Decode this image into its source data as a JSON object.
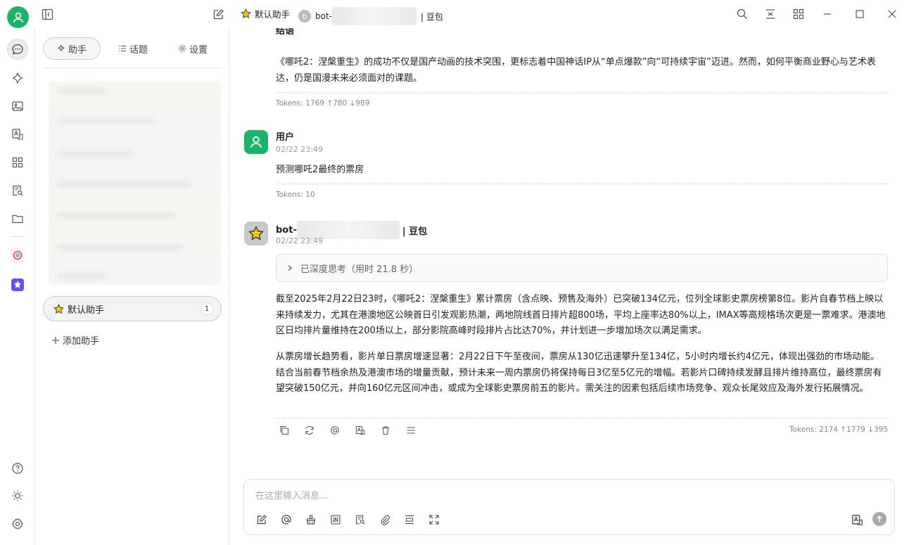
{
  "titlebar": {
    "assistant_label": "默认助手",
    "bot_prefix": "bot-",
    "bot_initial": "b",
    "bot_suffix": "| 豆包"
  },
  "sidebar": {
    "tabs": [
      {
        "label": "助手",
        "icon": "sparkle-icon"
      },
      {
        "label": "话题",
        "icon": "list-icon"
      },
      {
        "label": "设置",
        "icon": "gear-icon"
      }
    ],
    "assistant_item": {
      "label": "默认助手",
      "badge": "1"
    },
    "add_assistant": "添加助手"
  },
  "chat": {
    "prev_heading": "结语",
    "prev_text": "《哪吒2：涅槃重生》的成功不仅是国产动画的技术突围，更标志着中国神话IP从“单点爆款”向“可持续宇宙”迈进。然而，如何平衡商业野心与艺术表达，仍是国漫未来必须面对的课题。",
    "prev_tokens": "Tokens: 1769 ↑780 ↓989",
    "user_name": "用户",
    "user_time": "02/22 23:49",
    "user_text": "预测哪吒2最终的票房",
    "user_tokens": "Tokens: 10",
    "bot_name_prefix": "bot-",
    "bot_name_suffix": "| 豆包",
    "bot_time": "02/22 23:49",
    "think_label": "已深度思考（用时 21.8 秒）",
    "bot_para1": "截至2025年2月22日23时，《哪吒2：涅槃重生》累计票房（含点映、预售及海外）已突破134亿元，位列全球影史票房榜第8位。影片自春节档上映以来持续发力，尤其在港澳地区公映首日引发观影热潮，两地院线首日排片超800场，平均上座率达80%以上，IMAX等高规格场次更是一票难求。港澳地区日均排片量维持在200场以上，部分影院高峰时段排片占比达70%，并计划进一步增加场次以满足需求。",
    "bot_para2": "从票房增长趋势看，影片单日票房增速显著：2月22日下午至夜间，票房从130亿迅速攀升至134亿，5小时内增长约4亿元，体现出强劲的市场动能。结合当前春节档余热及港澳市场的增量贡献，预计未来一周内票房仍将保持每日3亿至5亿元的增幅。若影片口碑持续发酵且排片维持高位，最终票房有望突破150亿元，并向160亿元区间冲击，或成为全球影史票房前五的影片。需关注的因素包括后续市场竞争、观众长尾效应及海外发行拓展情况。",
    "bot_tokens": "Tokens: 2174 ↑1779 ↓395"
  },
  "input": {
    "placeholder": "在这里输入消息..."
  },
  "colors": {
    "accent": "#1ab46a",
    "brand_purple": "#6c4cf5"
  }
}
